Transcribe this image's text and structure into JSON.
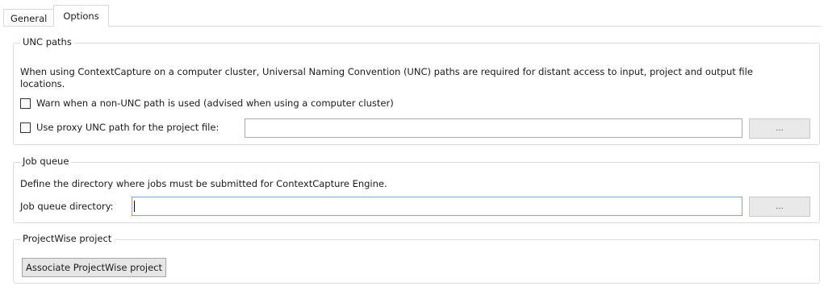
{
  "tabs": [
    {
      "label": "General",
      "active": false
    },
    {
      "label": "Options",
      "active": true
    }
  ],
  "unc_paths": {
    "title": "UNC paths",
    "description_line1": "When using ContextCapture on a computer cluster, Universal Naming Convention (UNC) paths are required for distant access to input, project and output file",
    "description_line2": "locations.",
    "warn_checkbox": {
      "label": "Warn when a non-UNC path is used (advised when using a computer cluster)",
      "checked": false
    },
    "proxy_checkbox": {
      "label": "Use proxy UNC path for the project file:",
      "checked": false
    },
    "proxy_path_value": "",
    "browse_label": "..."
  },
  "job_queue": {
    "title": "Job queue",
    "description": "Define the directory where jobs must be submitted for ContextCapture Engine.",
    "directory_label": "Job queue directory:",
    "directory_value": "",
    "browse_label": "..."
  },
  "projectwise": {
    "title": "ProjectWise project",
    "associate_button": "Associate ProjectWise project"
  }
}
